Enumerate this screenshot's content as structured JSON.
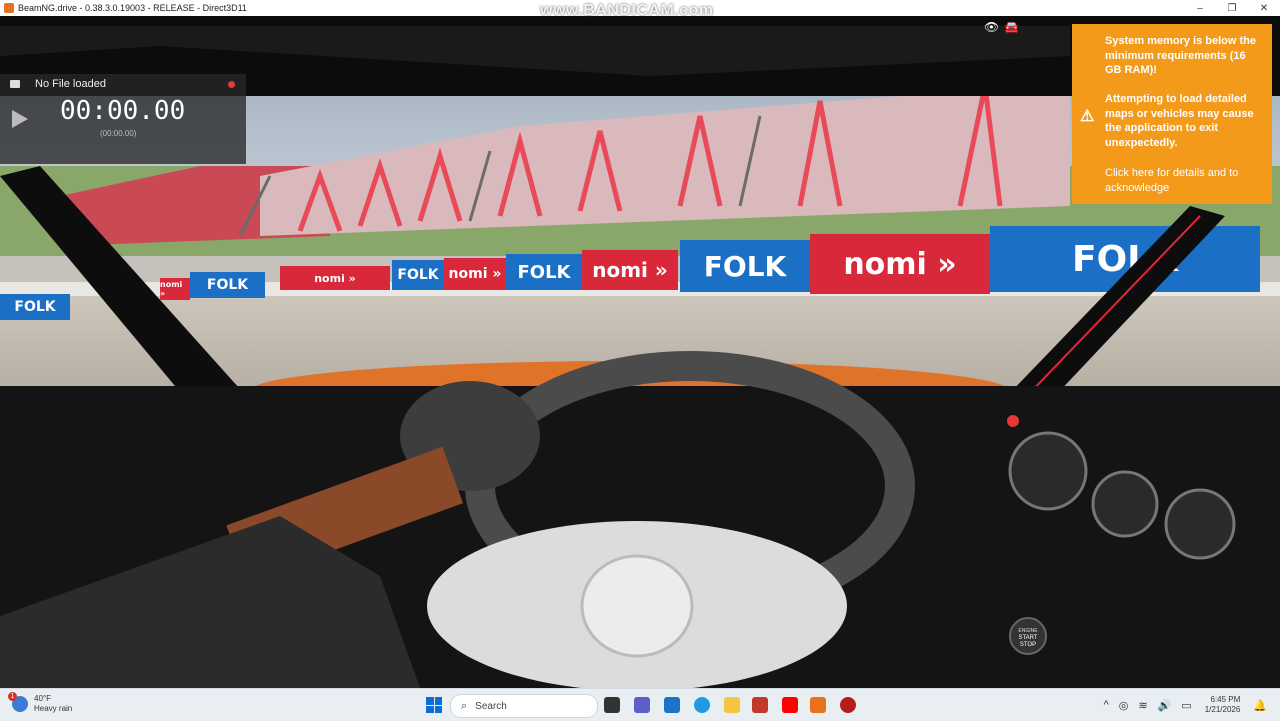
{
  "window": {
    "title": "BeamNG.drive - 0.38.3.0.19003 - RELEASE - Direct3D11",
    "controls": [
      "–",
      "❐",
      "✕"
    ]
  },
  "watermark": "www.BANDICAM.com",
  "replay": {
    "file_label": "No File loaded",
    "time": "00:00.00",
    "subtime": "(00:00.00)"
  },
  "hud_icons": [
    "eye-icon",
    "car-icon"
  ],
  "track_banners": [
    "FOLK",
    "nomi »",
    "FOLK",
    "nomi »",
    "FOLK",
    "nomi »",
    "FOLK",
    "nomi »",
    "FOLK"
  ],
  "warning": {
    "line1": "System memory is below the minimum requirements (16 GB RAM)!",
    "line2": "Attempting to load detailed maps or vehicles may cause the application to exit unexpectedly.",
    "line3": "Click here for details and to acknowledge",
    "color": "#f39a1b"
  },
  "taskbar": {
    "weather_temp": "40°F",
    "weather_desc": "Heavy rain",
    "weather_badge": "1",
    "search_placeholder": "Search",
    "time": "6:45 PM",
    "date": "1/21/2026"
  },
  "colors": {
    "accent_red": "#e53935",
    "banner_blue": "#1b6fc4",
    "banner_red": "#d8283a"
  }
}
